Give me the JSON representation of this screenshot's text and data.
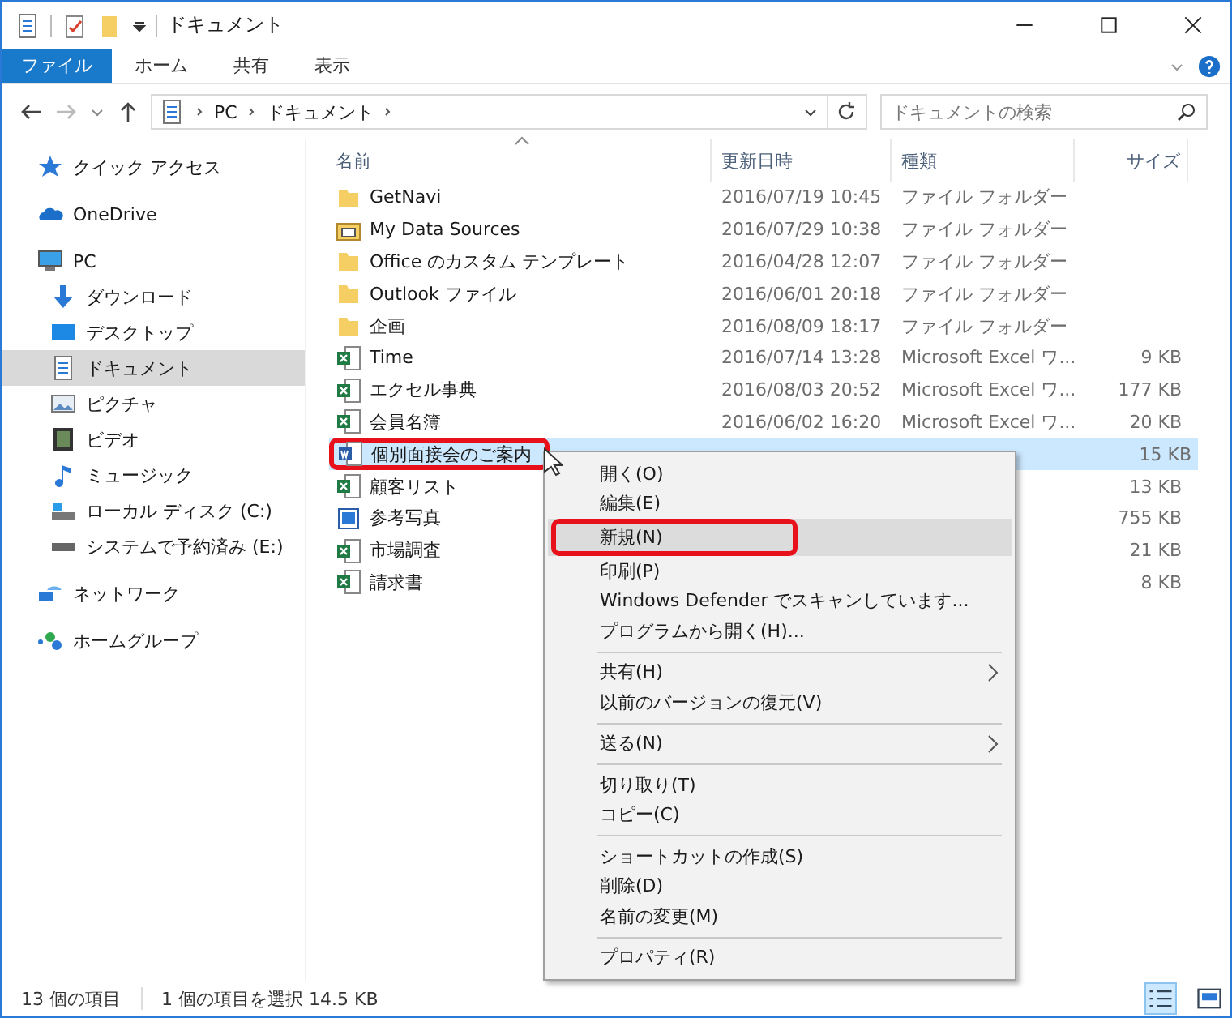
{
  "window": {
    "title": "ドキュメント"
  },
  "ribbon_tabs": [
    {
      "label": "ファイル",
      "selected": true
    },
    {
      "label": "ホーム",
      "selected": false
    },
    {
      "label": "共有",
      "selected": false
    },
    {
      "label": "表示",
      "selected": false
    }
  ],
  "address": {
    "crumbs": [
      "PC",
      "ドキュメント"
    ]
  },
  "search": {
    "placeholder": "ドキュメントの検索"
  },
  "sidebar": {
    "items": [
      {
        "label": "クイック アクセス",
        "kind": "star",
        "selected": false
      },
      {
        "label": "OneDrive",
        "kind": "cloud",
        "selected": false
      },
      {
        "label": "PC",
        "kind": "pc",
        "selected": false,
        "children": [
          {
            "label": "ダウンロード",
            "kind": "download",
            "selected": false
          },
          {
            "label": "デスクトップ",
            "kind": "desktop",
            "selected": false
          },
          {
            "label": "ドキュメント",
            "kind": "document",
            "selected": true
          },
          {
            "label": "ピクチャ",
            "kind": "picture",
            "selected": false
          },
          {
            "label": "ビデオ",
            "kind": "video",
            "selected": false
          },
          {
            "label": "ミュージック",
            "kind": "music",
            "selected": false
          },
          {
            "label": "ローカル ディスク (C:)",
            "kind": "disk",
            "selected": false
          },
          {
            "label": "システムで予約済み (E:)",
            "kind": "drive",
            "selected": false
          }
        ]
      },
      {
        "label": "ネットワーク",
        "kind": "network",
        "selected": false
      },
      {
        "label": "ホームグループ",
        "kind": "homegroup",
        "selected": false
      }
    ]
  },
  "table": {
    "columns": [
      "名前",
      "更新日時",
      "種類",
      "サイズ"
    ],
    "rows": [
      {
        "name": "GetNavi",
        "kind": "folder",
        "date": "2016/07/19 10:45",
        "type": "ファイル フォルダー",
        "selected": false,
        "highlighted": false
      },
      {
        "name": "My Data Sources",
        "kind": "datasource",
        "date": "2016/07/29 10:38",
        "type": "ファイル フォルダー",
        "selected": false,
        "highlighted": false
      },
      {
        "name": "Office のカスタム テンプレート",
        "kind": "folder",
        "date": "2016/04/28 12:07",
        "type": "ファイル フォルダー",
        "selected": false,
        "highlighted": false
      },
      {
        "name": "Outlook ファイル",
        "kind": "folder",
        "date": "2016/06/01 20:18",
        "type": "ファイル フォルダー",
        "selected": false,
        "highlighted": false
      },
      {
        "name": "企画",
        "kind": "folder",
        "date": "2016/08/09 18:17",
        "type": "ファイル フォルダー",
        "selected": false,
        "highlighted": false
      },
      {
        "name": "Time",
        "kind": "excel",
        "date": "2016/07/14 13:28",
        "type": "Microsoft Excel ワ...",
        "size": "9 KB",
        "selected": false,
        "highlighted": false
      },
      {
        "name": "エクセル事典",
        "kind": "excel",
        "date": "2016/08/03 20:52",
        "type": "Microsoft Excel ワ...",
        "size": "177 KB",
        "selected": false,
        "highlighted": false
      },
      {
        "name": "会員名簿",
        "kind": "excel",
        "date": "2016/06/02 16:20",
        "type": "Microsoft Excel ワ...",
        "size": "20 KB",
        "selected": false,
        "highlighted": false
      },
      {
        "name": "個別面接会のご案内",
        "kind": "word",
        "size": "15 KB",
        "selected": true,
        "highlighted": true
      },
      {
        "name": "顧客リスト",
        "kind": "excel",
        "size": "13 KB",
        "selected": false,
        "highlighted": false
      },
      {
        "name": "参考写真",
        "kind": "image",
        "size": "755 KB",
        "selected": false,
        "highlighted": false
      },
      {
        "name": "市場調査",
        "kind": "excel",
        "size": "21 KB",
        "selected": false,
        "highlighted": false
      },
      {
        "name": "請求書",
        "kind": "excel",
        "size": "8 KB",
        "selected": false,
        "highlighted": false
      }
    ]
  },
  "context_menu": {
    "groups": [
      [
        {
          "label": "開く(O)",
          "selected": false,
          "highlighted": false,
          "submenu": false
        },
        {
          "label": "編集(E)",
          "selected": false,
          "highlighted": false,
          "submenu": false
        },
        {
          "label": "新規(N)",
          "selected": true,
          "highlighted": true,
          "submenu": false
        },
        {
          "label": "印刷(P)",
          "selected": false,
          "highlighted": false,
          "submenu": false
        },
        {
          "label": "Windows Defender でスキャンしています...",
          "selected": false,
          "highlighted": false,
          "submenu": false
        },
        {
          "label": "プログラムから開く(H)...",
          "selected": false,
          "highlighted": false,
          "submenu": false
        }
      ],
      [
        {
          "label": "共有(H)",
          "selected": false,
          "highlighted": false,
          "submenu": true
        },
        {
          "label": "以前のバージョンの復元(V)",
          "selected": false,
          "highlighted": false,
          "submenu": false
        }
      ],
      [
        {
          "label": "送る(N)",
          "selected": false,
          "highlighted": false,
          "submenu": true
        }
      ],
      [
        {
          "label": "切り取り(T)",
          "selected": false,
          "highlighted": false,
          "submenu": false
        },
        {
          "label": "コピー(C)",
          "selected": false,
          "highlighted": false,
          "submenu": false
        }
      ],
      [
        {
          "label": "ショートカットの作成(S)",
          "selected": false,
          "highlighted": false,
          "submenu": false
        },
        {
          "label": "削除(D)",
          "selected": false,
          "highlighted": false,
          "submenu": false
        },
        {
          "label": "名前の変更(M)",
          "selected": false,
          "highlighted": false,
          "submenu": false
        }
      ],
      [
        {
          "label": "プロパティ(R)",
          "selected": false,
          "highlighted": false,
          "submenu": false
        }
      ]
    ]
  },
  "status_bar": {
    "count": "13 個の項目",
    "selection": "1 個の項目を選択  14.5 KB"
  }
}
